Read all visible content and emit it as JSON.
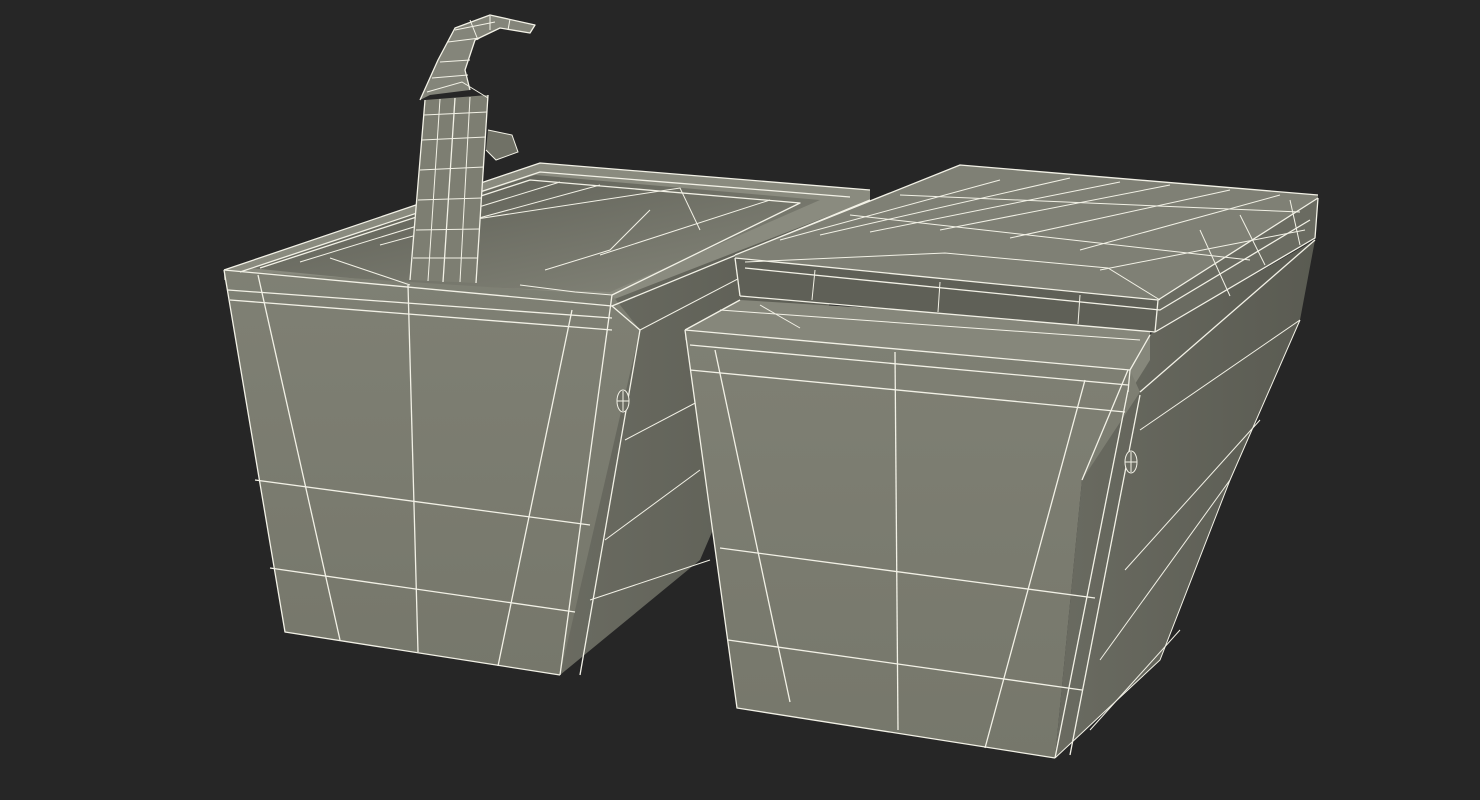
{
  "scene": {
    "background_color": "#262626",
    "surface_color": "#7b7c70",
    "wire_color": "#f2f1e6",
    "objects": [
      "bidet",
      "faucet",
      "toilet"
    ],
    "render_style": "wireframe over solid shading"
  }
}
